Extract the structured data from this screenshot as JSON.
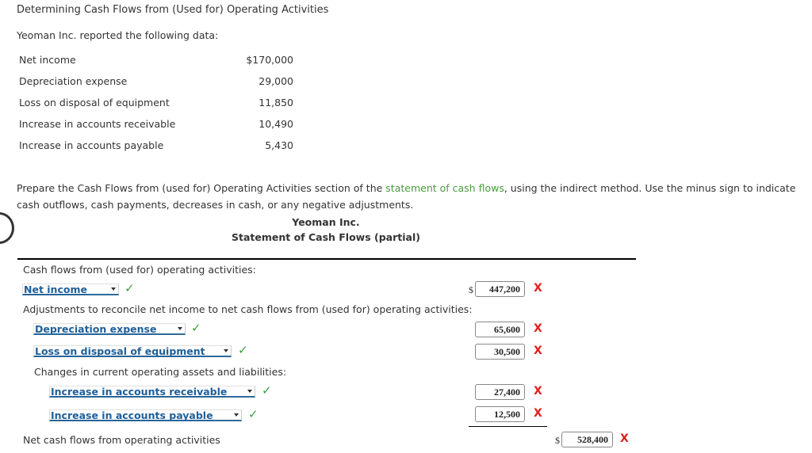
{
  "title": "Determining Cash Flows from (Used for) Operating Activities",
  "intro": "Yeoman Inc. reported the following data:",
  "given": [
    {
      "label": "Net income",
      "value": "$170,000"
    },
    {
      "label": "Depreciation expense",
      "value": "29,000"
    },
    {
      "label": "Loss on disposal of equipment",
      "value": "11,850"
    },
    {
      "label": "Increase in accounts receivable",
      "value": "10,490"
    },
    {
      "label": "Increase in accounts payable",
      "value": "5,430"
    }
  ],
  "instructions": {
    "before": "Prepare the Cash Flows from (used for) Operating Activities section of the ",
    "link": "statement of cash flows",
    "after": ", using the indirect method. Use the minus sign to indicate cash outflows, cash payments, decreases in cash, or any negative adjustments."
  },
  "statement": {
    "company": "Yeoman Inc.",
    "name": "Statement of Cash Flows (partial)",
    "section_header": "Cash flows from (used for) operating activities:",
    "adjustments_label": "Adjustments to reconcile net income to net cash flows from (used for) operating activities:",
    "changes_label": "Changes in current operating assets and liabilities:",
    "total_label": "Net cash flows from operating activities",
    "currency": "$",
    "rows": [
      {
        "selected": "Net income",
        "status": "correct",
        "amount": "447,200",
        "amount_status": "incorrect"
      },
      {
        "selected": "Depreciation expense",
        "status": "correct",
        "amount": "65,600",
        "amount_status": "incorrect"
      },
      {
        "selected": "Loss on disposal of equipment",
        "status": "correct",
        "amount": "30,500",
        "amount_status": "incorrect"
      },
      {
        "selected": "Increase in accounts receivable",
        "status": "correct",
        "amount": "27,400",
        "amount_status": "incorrect"
      },
      {
        "selected": "Increase in accounts payable",
        "status": "correct",
        "amount": "12,500",
        "amount_status": "incorrect"
      }
    ],
    "total": {
      "amount": "528,400",
      "amount_status": "incorrect"
    },
    "check_glyph": "✓",
    "x_glyph": "X"
  }
}
